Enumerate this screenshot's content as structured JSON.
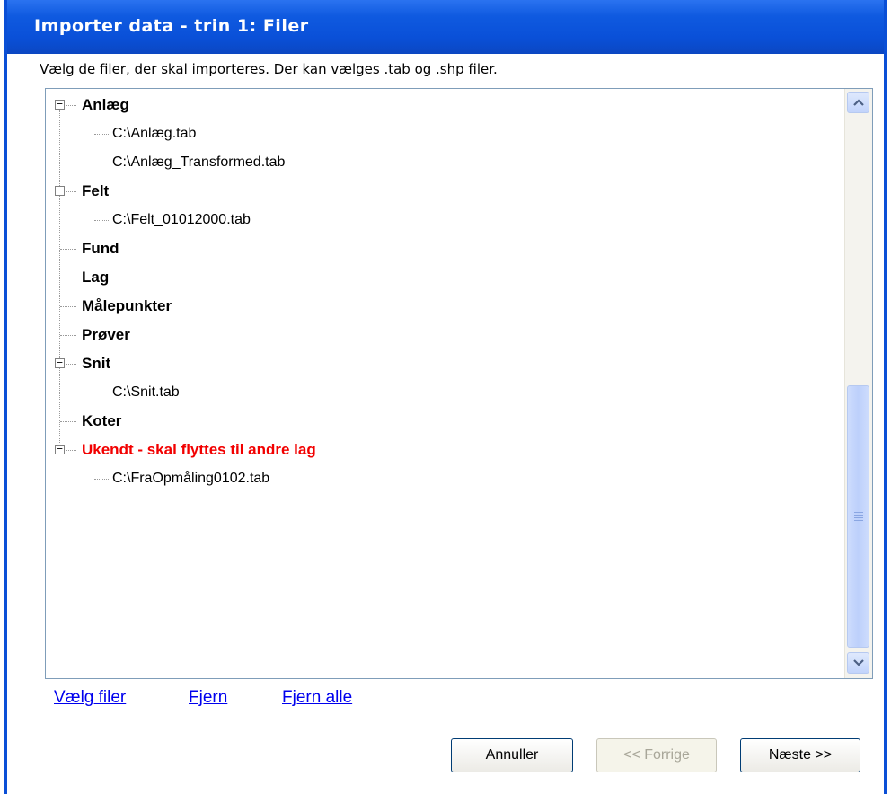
{
  "window": {
    "title": "Importer data - trin 1: Filer",
    "instruction": "Vælg de filer, der skal importeres. Der kan vælges .tab og .shp filer."
  },
  "tree": {
    "nodes": [
      {
        "label": "Anlæg",
        "expanded": true
      },
      {
        "label": "C:\\Anlæg.tab"
      },
      {
        "label": "C:\\Anlæg_Transformed.tab"
      },
      {
        "label": "Felt",
        "expanded": true
      },
      {
        "label": "C:\\Felt_01012000.tab"
      },
      {
        "label": "Fund"
      },
      {
        "label": "Lag"
      },
      {
        "label": "Målepunkter"
      },
      {
        "label": "Prøver"
      },
      {
        "label": "Snit",
        "expanded": true
      },
      {
        "label": "C:\\Snit.tab"
      },
      {
        "label": "Koter"
      },
      {
        "label": "Ukendt - skal flyttes til andre lag",
        "expanded": true,
        "color": "#f20000"
      },
      {
        "label": "C:\\FraOpmåling0102.tab"
      }
    ],
    "expander_symbol": "−"
  },
  "links": {
    "choose_files": "Vælg filer",
    "remove": "Fjern",
    "remove_all": "Fjern alle"
  },
  "buttons": {
    "cancel": "Annuller",
    "previous": "<< Forrige",
    "next": "Næste >>"
  },
  "colors": {
    "titlebar": "#0a50d8",
    "link": "#0000ee",
    "warning_text": "#f20000"
  }
}
